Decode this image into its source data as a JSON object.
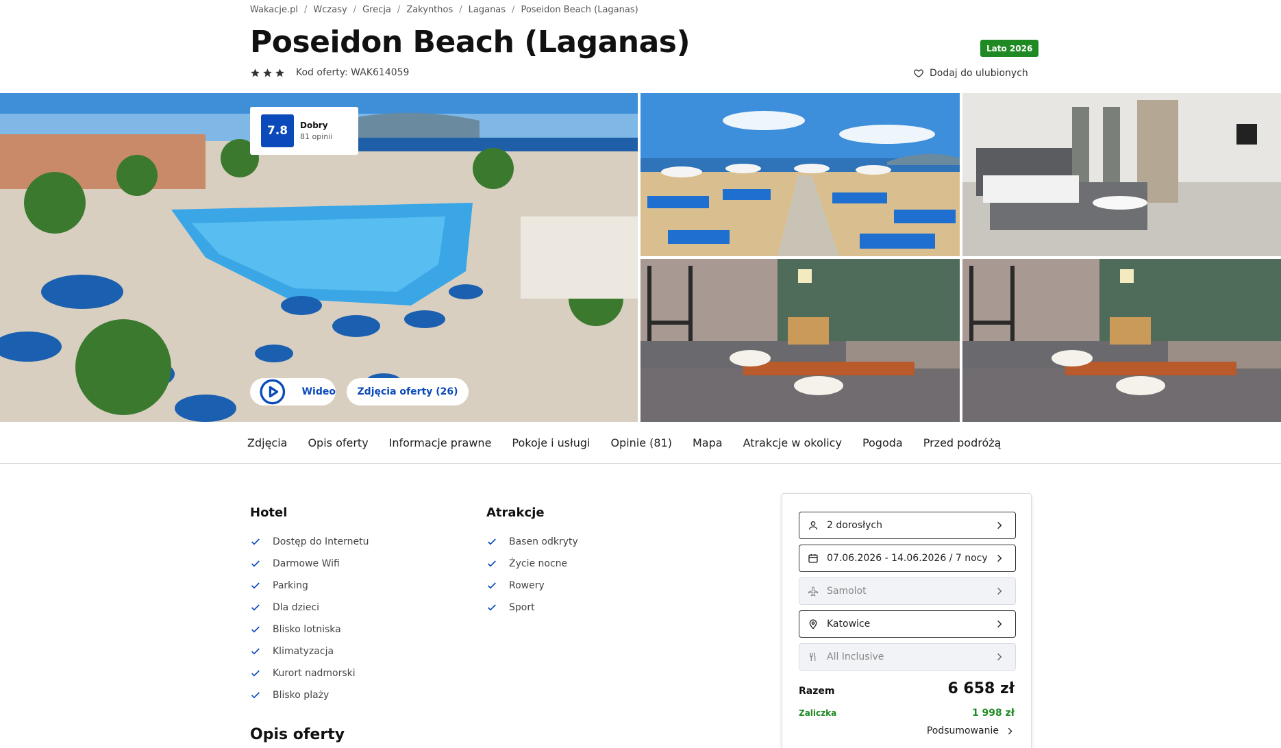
{
  "breadcrumb": [
    "Wakacje.pl",
    "Wczasy",
    "Grecja",
    "Zakynthos",
    "Laganas",
    "Poseidon Beach (Laganas)"
  ],
  "breadcrumb_separator": "/",
  "title": "Poseidon Beach (Laganas)",
  "season_badge": "Lato 2026",
  "stars": 3,
  "offer_code": "Kod oferty: WAK614059",
  "favorite_label": "Dodaj do ulubionych",
  "rating": {
    "score": "7.8",
    "label": "Dobry",
    "count": "81 opinii"
  },
  "gallery": {
    "video_label": "Wideo",
    "photos_label": "Zdjęcia oferty (26)"
  },
  "tabs": [
    "Zdjęcia",
    "Opis oferty",
    "Informacje prawne",
    "Pokoje i usługi",
    "Opinie (81)",
    "Mapa",
    "Atrakcje w okolicy",
    "Pogoda",
    "Przed podróżą"
  ],
  "hotel": {
    "heading": "Hotel",
    "items": [
      "Dostęp do Internetu",
      "Darmowe Wifi",
      "Parking",
      "Dla dzieci",
      "Blisko lotniska",
      "Klimatyzacja",
      "Kurort nadmorski",
      "Blisko plaży"
    ]
  },
  "attractions": {
    "heading": "Atrakcje",
    "items": [
      "Basen odkryty",
      "Życie nocne",
      "Rowery",
      "Sport"
    ]
  },
  "opis_heading": "Opis oferty",
  "booking": {
    "participants": "2 dorosłych",
    "dates": "07.06.2026 - 14.06.2026 / 7 nocy",
    "transport": "Samolot",
    "departure": "Katowice",
    "board": "All Inclusive",
    "total_label": "Razem",
    "total_value": "6 658 zł",
    "deposit_label": "Zaliczka",
    "deposit_value": "1 998 zł",
    "summary_label": "Podsumowanie"
  },
  "colors": {
    "brand_blue": "#0b4aba",
    "green": "#1f8a23"
  }
}
